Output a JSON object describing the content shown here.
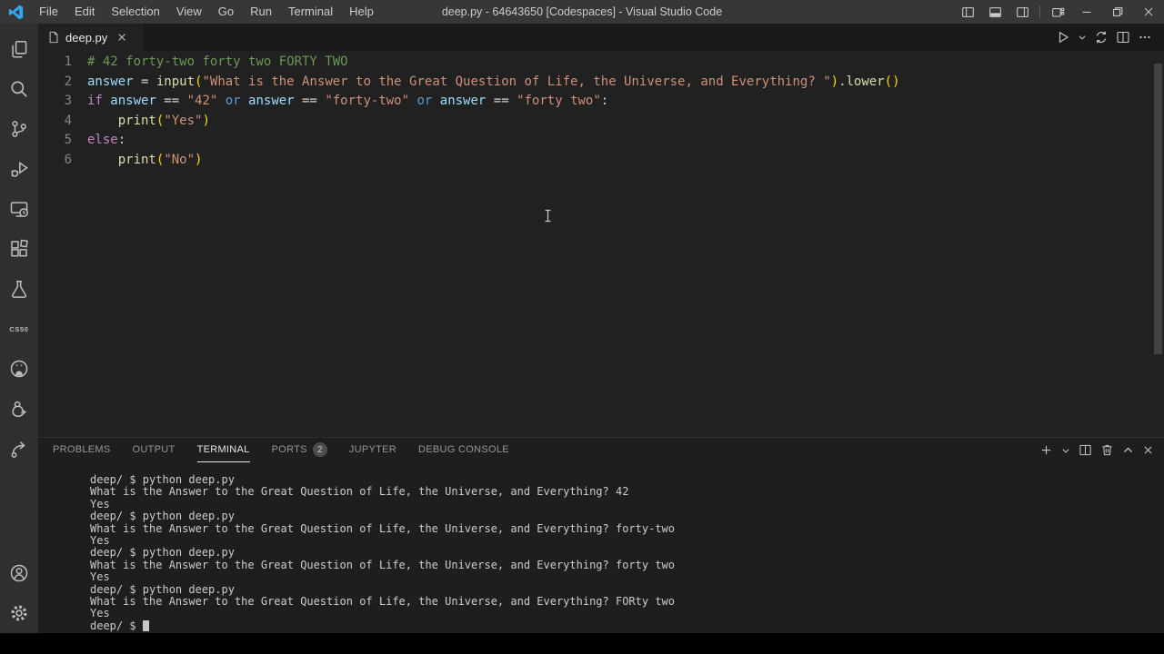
{
  "titlebar": {
    "title": "deep.py - 64643650 [Codespaces] - Visual Studio Code",
    "menus": [
      "File",
      "Edit",
      "Selection",
      "View",
      "Go",
      "Run",
      "Terminal",
      "Help"
    ],
    "window_icons": [
      "toggle-primary-sidebar",
      "toggle-panel",
      "toggle-secondary-sidebar",
      "customize-layout",
      "minimize",
      "restore",
      "close"
    ]
  },
  "activity_bar": {
    "icons": [
      "explorer",
      "search",
      "source-control",
      "run-and-debug",
      "remote-explorer",
      "extensions",
      "testing",
      "cs50",
      "github",
      "duck-debugger",
      "submit-arrow"
    ],
    "bottom_icons": [
      "accounts",
      "settings-gear"
    ],
    "cs50_label": "CS50"
  },
  "tab": {
    "label": "deep.py"
  },
  "editor_actions": [
    "run",
    "run-dropdown",
    "open-changes",
    "split-editor",
    "more-actions"
  ],
  "editor": {
    "lines": [
      {
        "num": "1",
        "tokens": [
          {
            "c": "cm",
            "t": "# 42 forty-two forty two FORTY TWO"
          }
        ]
      },
      {
        "num": "2",
        "tokens": [
          {
            "c": "var",
            "t": "answer"
          },
          {
            "c": "pl",
            "t": " = "
          },
          {
            "c": "fn",
            "t": "input"
          },
          {
            "c": "br",
            "t": "("
          },
          {
            "c": "st",
            "t": "\"What is the Answer to the Great Question of Life, the Universe, and Everything? \""
          },
          {
            "c": "br",
            "t": ")"
          },
          {
            "c": "pl",
            "t": "."
          },
          {
            "c": "fn",
            "t": "lower"
          },
          {
            "c": "br",
            "t": "()"
          }
        ]
      },
      {
        "num": "3",
        "tokens": [
          {
            "c": "kw",
            "t": "if"
          },
          {
            "c": "pl",
            "t": " "
          },
          {
            "c": "var",
            "t": "answer"
          },
          {
            "c": "pl",
            "t": " == "
          },
          {
            "c": "st",
            "t": "\"42\""
          },
          {
            "c": "blue",
            "t": " or "
          },
          {
            "c": "var",
            "t": "answer"
          },
          {
            "c": "pl",
            "t": " == "
          },
          {
            "c": "st",
            "t": "\"forty-two\""
          },
          {
            "c": "blue",
            "t": " or "
          },
          {
            "c": "var",
            "t": "answer"
          },
          {
            "c": "pl",
            "t": " == "
          },
          {
            "c": "st",
            "t": "\"forty two\""
          },
          {
            "c": "pl",
            "t": ":"
          }
        ]
      },
      {
        "num": "4",
        "tokens": [
          {
            "c": "pl",
            "t": "    "
          },
          {
            "c": "fn",
            "t": "print"
          },
          {
            "c": "br",
            "t": "("
          },
          {
            "c": "st",
            "t": "\"Yes\""
          },
          {
            "c": "br",
            "t": ")"
          }
        ]
      },
      {
        "num": "5",
        "tokens": [
          {
            "c": "kw",
            "t": "else"
          },
          {
            "c": "pl",
            "t": ":"
          }
        ]
      },
      {
        "num": "6",
        "tokens": [
          {
            "c": "pl",
            "t": "    "
          },
          {
            "c": "fn",
            "t": "print"
          },
          {
            "c": "br",
            "t": "("
          },
          {
            "c": "st",
            "t": "\"No\""
          },
          {
            "c": "br",
            "t": ")"
          }
        ]
      }
    ]
  },
  "panel": {
    "tabs": [
      {
        "label": "PROBLEMS"
      },
      {
        "label": "OUTPUT"
      },
      {
        "label": "TERMINAL"
      },
      {
        "label": "PORTS",
        "badge": "2"
      },
      {
        "label": "JUPYTER"
      },
      {
        "label": "DEBUG CONSOLE"
      }
    ],
    "active": "TERMINAL",
    "actions": [
      "new-terminal",
      "launch-profile-dropdown",
      "split-terminal",
      "kill-terminal",
      "maximize-panel",
      "close-panel"
    ]
  },
  "terminal": {
    "cursor": true,
    "lines": [
      "deep/ $ python deep.py",
      "What is the Answer to the Great Question of Life, the Universe, and Everything? 42",
      "Yes",
      "deep/ $ python deep.py",
      "What is the Answer to the Great Question of Life, the Universe, and Everything? forty-two",
      "Yes",
      "deep/ $ python deep.py",
      "What is the Answer to the Great Question of Life, the Universe, and Everything? forty two",
      "Yes",
      "deep/ $ python deep.py",
      "What is the Answer to the Great Question of Life, the Universe, and Everything? FORty two",
      "Yes",
      "deep/ $ "
    ]
  },
  "colors": {
    "titlebar_bg": "#37373a",
    "activitybar_bg": "#2f2f32",
    "editor_bg": "#212121",
    "panel_bg": "#1e1e1e",
    "tabstrip_bg": "#191919",
    "badge_bg": "#4d4d4d",
    "comment": "#6a9955",
    "string": "#ce9178",
    "keyword": "#c586c0",
    "logical_keyword": "#569cd6",
    "variable": "#9cdcfe",
    "function": "#dcdcaa",
    "bracket_pair": "#ffd700",
    "terminal_text": "#cccccc"
  }
}
